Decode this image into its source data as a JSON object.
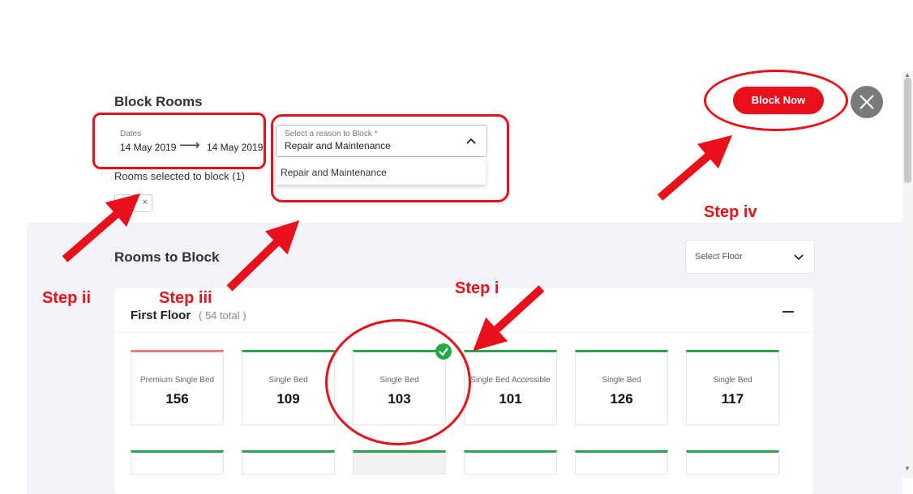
{
  "header": {
    "title": "Block Rooms",
    "dates_label": "Dates",
    "date_from": "14 May 2019",
    "date_arrow": "⟶",
    "date_to": "14 May 2019",
    "reason_label": "Select a reason to Block *",
    "reason_value": "Repair and Maintenance",
    "dropdown_options": [
      "Repair and Maintenance"
    ],
    "rooms_selected_label": "Rooms selected to block (1)",
    "chip_close": "×",
    "block_now_label": "Block Now"
  },
  "rooms_panel": {
    "title": "Rooms to Block",
    "floor_select_placeholder": "Select Floor",
    "floor_name": "First Floor",
    "floor_total": "( 54 total )",
    "rooms": [
      {
        "type": "Premium Single Bed",
        "number": "156",
        "status": "red"
      },
      {
        "type": "Single Bed",
        "number": "109",
        "status": "green"
      },
      {
        "type": "Single Bed",
        "number": "103",
        "status": "green",
        "selected": true
      },
      {
        "type": "Single Bed Accessible",
        "number": "101",
        "status": "green"
      },
      {
        "type": "Single Bed",
        "number": "126",
        "status": "green"
      },
      {
        "type": "Single Bed",
        "number": "117",
        "status": "green"
      }
    ]
  },
  "annotations": {
    "step_i": "Step i",
    "step_ii": "Step ii",
    "step_iii": "Step iii",
    "step_iv": "Step iv"
  },
  "colors": {
    "accent": "#e8101a",
    "available": "#28a745",
    "blocked": "#f07a7a",
    "panel_bg": "#f1f3f6"
  }
}
